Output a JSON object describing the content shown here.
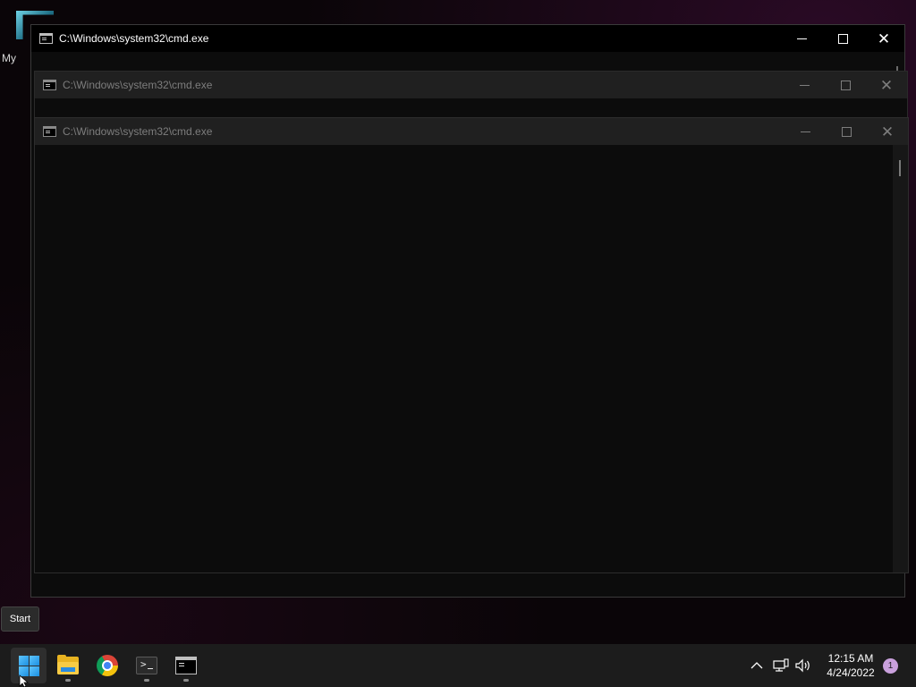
{
  "desktop": {
    "icon_label": "My"
  },
  "windows": [
    {
      "title": "C:\\Windows\\system32\\cmd.exe",
      "state": "active"
    },
    {
      "title": "C:\\Windows\\system32\\cmd.exe",
      "state": "inactive"
    },
    {
      "title": "C:\\Windows\\system32\\cmd.exe",
      "state": "inactive"
    }
  ],
  "window_controls": {
    "minimize": "minimize-icon",
    "maximize": "maximize-icon",
    "close": "close-icon"
  },
  "tooltip": {
    "text": "Start"
  },
  "taskbar": {
    "apps": [
      {
        "name": "Start",
        "icon": "windows-logo-icon"
      },
      {
        "name": "File Explorer",
        "icon": "folder-icon"
      },
      {
        "name": "Google Chrome",
        "icon": "chrome-icon"
      },
      {
        "name": "Windows Terminal",
        "icon": "terminal-icon"
      },
      {
        "name": "Command Prompt",
        "icon": "cmd-icon"
      }
    ],
    "tray": {
      "time": "12:15 AM",
      "date": "4/24/2022",
      "notifications": "1"
    }
  },
  "colors": {
    "taskbar_bg": "#1c1c1c",
    "console_bg": "#0c0c0c",
    "accent": "#1b8fe0"
  }
}
